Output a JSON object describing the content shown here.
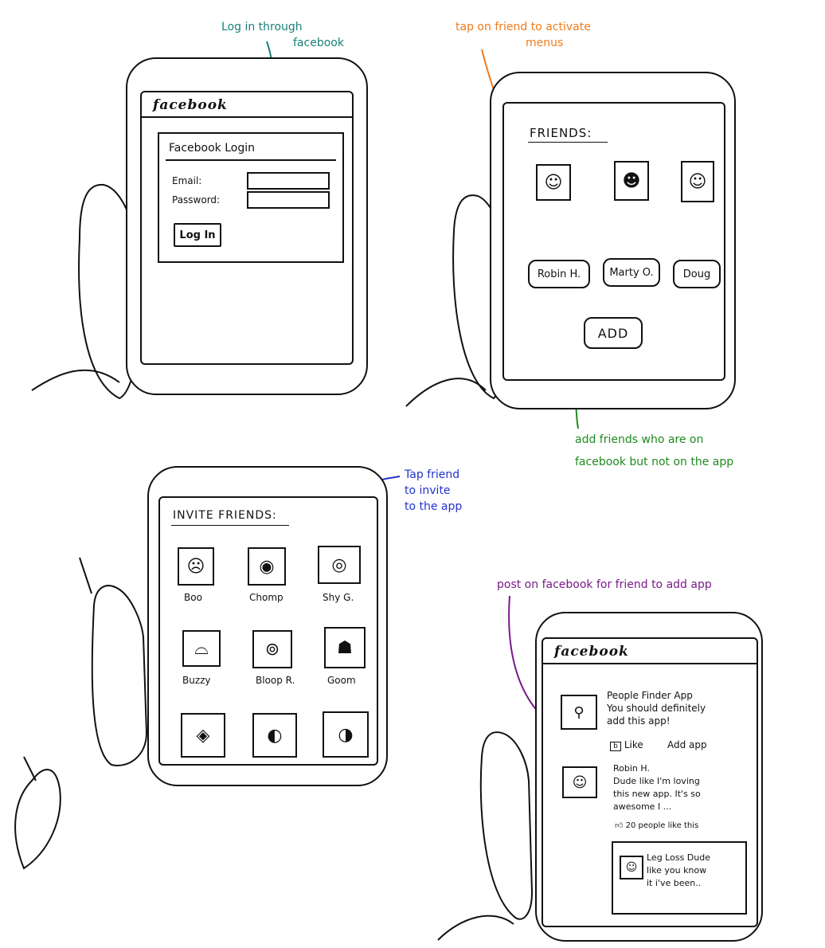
{
  "annotations": {
    "login": {
      "line1": "Log in through",
      "line2": "facebook",
      "color": "#1a7f7a"
    },
    "tap_friend": {
      "line1": "tap on friend to activate",
      "line2": "menus",
      "color": "#f07a1a"
    },
    "add_friends": {
      "line1": "add friends who are on",
      "line2": "facebook but not on the app",
      "color": "#1e8a1e"
    },
    "tap_invite": {
      "line1": "Tap friend",
      "line2": "to invite",
      "line3": "to the app",
      "color": "#2233cc"
    },
    "post": {
      "line1": "post on facebook for friend to add app",
      "color": "#7a1a8a"
    }
  },
  "login_screen": {
    "brand": "facebook",
    "form_title": "Facebook Login",
    "email_label": "Email:",
    "password_label": "Password:",
    "login_button": "Log In"
  },
  "friends_screen": {
    "heading": "FRIENDS:",
    "friends": [
      {
        "name": "Robin H.",
        "icon": "face-icon"
      },
      {
        "name": "Marty O.",
        "icon": "face-icon"
      },
      {
        "name": "Doug",
        "icon": "face-icon"
      }
    ],
    "add_button": "ADD"
  },
  "invite_screen": {
    "heading": "INVITE FRIENDS:",
    "friends": [
      {
        "name": "Boo",
        "icon": "ghost-icon"
      },
      {
        "name": "Chomp",
        "icon": "chomp-icon"
      },
      {
        "name": "Shy G.",
        "icon": "mask-icon"
      },
      {
        "name": "Buzzy",
        "icon": "shell-icon"
      },
      {
        "name": "Bloop R.",
        "icon": "squid-icon"
      },
      {
        "name": "Goom",
        "icon": "goomba-icon"
      },
      {
        "name": "",
        "icon": "creature-icon"
      },
      {
        "name": "",
        "icon": "fish-icon"
      },
      {
        "name": "",
        "icon": "bird-icon"
      }
    ]
  },
  "feed_screen": {
    "brand": "facebook",
    "post1": {
      "title": "People Finder App",
      "line1": "You should definitely",
      "line2": "add this app!",
      "like": "Like",
      "add_app": "Add app"
    },
    "post2": {
      "author": "Robin H.",
      "line1": "Dude like I'm loving",
      "line2": "this new app. It's so",
      "line3": "awesome I ...",
      "likes": "20 people like this"
    },
    "comment": {
      "line1": "Leg Loss Dude",
      "line2": "like you know",
      "line3": "it i've been.."
    }
  }
}
